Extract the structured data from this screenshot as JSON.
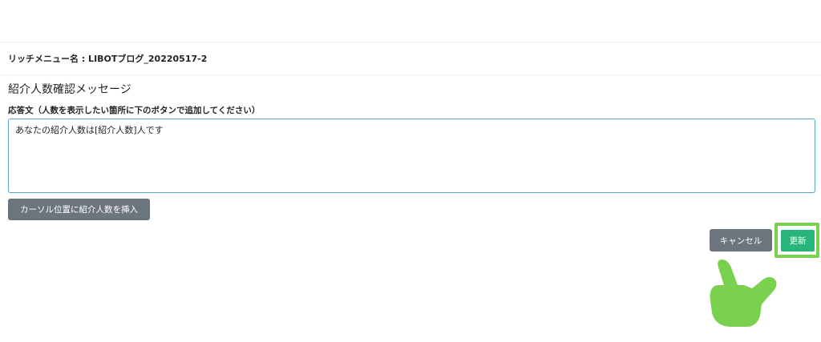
{
  "header": {
    "menu_name": "リッチメニュー名 : LIBOTブログ_20220517-2"
  },
  "form": {
    "section_title": "紹介人数確認メッセージ",
    "field_label": "応答文（人数を表示したい箇所に下のボタンで追加してください）",
    "response_value": "あなたの紹介人数は[紹介人数]人です",
    "insert_button_label": "カーソル位置に紹介人数を挿入"
  },
  "actions": {
    "cancel_label": "キャンセル",
    "update_label": "更新"
  },
  "colors": {
    "secondary_button": "#6c757d",
    "primary_button": "#28b57a",
    "highlight": "#7ad14e",
    "textarea_border": "#5fa3cf"
  },
  "icons": {
    "annotation": "pointing-hand-icon"
  }
}
